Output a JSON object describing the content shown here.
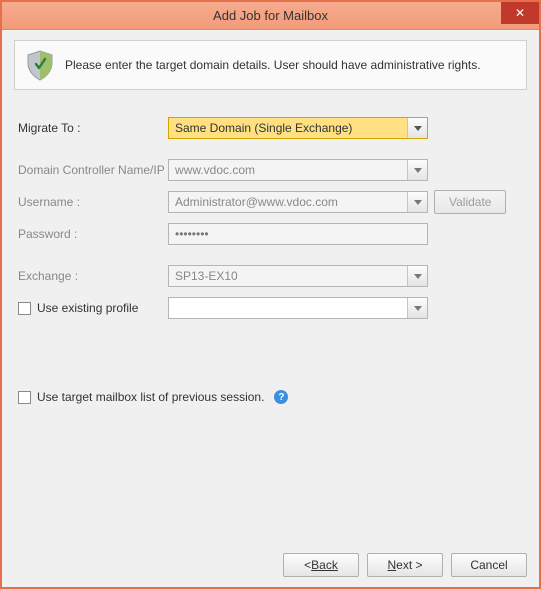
{
  "window": {
    "title": "Add Job for Mailbox"
  },
  "info": {
    "text": "Please enter the target domain details. User should have administrative rights."
  },
  "form": {
    "migrateTo": {
      "label": "Migrate To :",
      "value": "Same Domain (Single Exchange)"
    },
    "dcName": {
      "label": "Domain Controller Name/IP",
      "value": "www.vdoc.com"
    },
    "username": {
      "label": "Username :",
      "value": "Administrator@www.vdoc.com"
    },
    "password": {
      "label": "Password :",
      "value": "••••••••"
    },
    "exchange": {
      "label": "Exchange :",
      "value": "SP13-EX10"
    },
    "useExistingProfile": {
      "label": "Use existing profile",
      "checked": false,
      "value": ""
    },
    "validateLabel": "Validate"
  },
  "options": {
    "usePrevSession": {
      "label": "Use target mailbox list of previous session.",
      "checked": false
    }
  },
  "footer": {
    "back": "Back",
    "next": "Next >",
    "cancel": "Cancel"
  }
}
